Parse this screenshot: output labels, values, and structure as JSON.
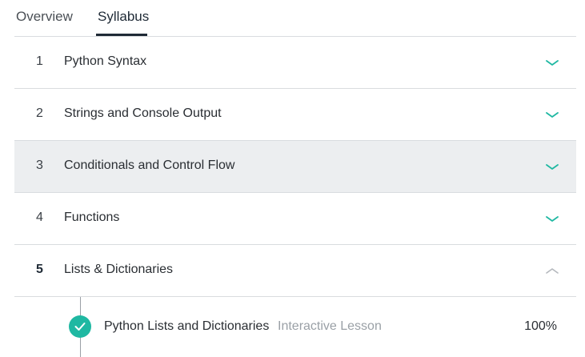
{
  "tabs": [
    {
      "label": "Overview",
      "active": false
    },
    {
      "label": "Syllabus",
      "active": true
    }
  ],
  "syllabus": [
    {
      "number": "1",
      "title": "Python Syntax",
      "expanded": false
    },
    {
      "number": "2",
      "title": "Strings and Console Output",
      "expanded": false
    },
    {
      "number": "3",
      "title": "Conditionals and Control Flow",
      "expanded": false,
      "hovered": true
    },
    {
      "number": "4",
      "title": "Functions",
      "expanded": false
    },
    {
      "number": "5",
      "title": "Lists & Dictionaries",
      "expanded": true
    }
  ],
  "lessons": [
    {
      "title": "Python Lists and Dictionaries",
      "type": "Interactive Lesson",
      "progress": "100%",
      "completed": true
    }
  ],
  "colors": {
    "accent": "#1fb8a2",
    "chevron_collapsed": "#1fb8a2",
    "chevron_expanded": "#b4b8bd",
    "hover_row": "#eceef0"
  },
  "icons": {
    "collapsed": "chevron-down-icon",
    "expanded": "chevron-up-icon",
    "completed": "check-circle-icon"
  }
}
